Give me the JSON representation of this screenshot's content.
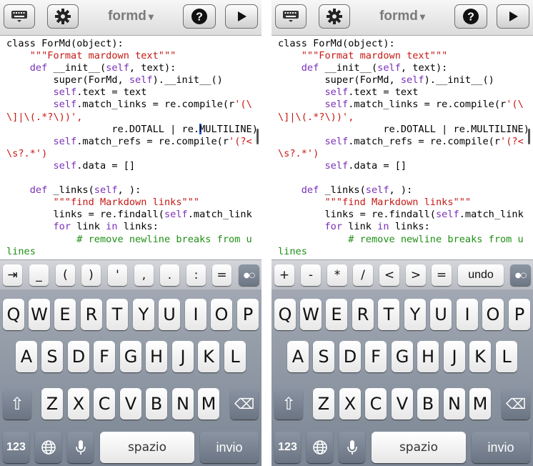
{
  "toolbar": {
    "title": "formd",
    "title_caret": "▾",
    "help_label": "?",
    "play_label": "▶"
  },
  "code": {
    "line1_a": "class ForMd(object):",
    "line2_pre": "    ",
    "line2_str": "\"\"\"Format mardown text\"\"\"",
    "line3_kw": "    def",
    "line3_rest": " __init__(",
    "line3_self": "self",
    "line3_end": ", text):",
    "line4_pre": "        super(ForMd, ",
    "line4_self": "self",
    "line4_end": ").__init__()",
    "line5_self": "        self",
    "line5_end": ".text = text",
    "line6_self": "        self",
    "line6_end": ".match_links = re.compile(r",
    "line6_str": "'(\\",
    "line7_str": "\\]|\\(.*?\\))',",
    "line8_left": "                  re.DOTALL | re.",
    "line8_right_left": "MULTILINE)",
    "line8_right_right": "MULTILINE)",
    "line9_self": "        self",
    "line9_end": ".match_refs = re.compile(r",
    "line9_str": "'(?<",
    "line10_str": "\\s?.*')",
    "line11_self": "        self",
    "line11_end": ".data = []",
    "line12": "",
    "line13_kw": "    def",
    "line13_end": " _links(",
    "line13_self": "self",
    "line13_end2": ", ):",
    "line14_pre": "        ",
    "line14_str": "\"\"\"find Markdown links\"\"\"",
    "line15_pre": "        links = re.findall(",
    "line15_self": "self",
    "line15_end": ".match_link",
    "line16_kw": "        for",
    "line16_mid": " link ",
    "line16_kw2": "in",
    "line16_end": " links:",
    "line17_cm": "            # remove newline breaks from u",
    "line18_cm": "lines"
  },
  "accessory_left": [
    "⇥",
    "_",
    "(",
    ")",
    "'",
    ",",
    ".",
    ":",
    "="
  ],
  "accessory_right": [
    "+",
    "-",
    "*",
    "/",
    "<",
    ">",
    "=",
    "undo"
  ],
  "accessory_toggle": "●○",
  "keyboard": {
    "row1": [
      "Q",
      "W",
      "E",
      "R",
      "T",
      "Y",
      "U",
      "I",
      "O",
      "P"
    ],
    "row2": [
      "A",
      "S",
      "D",
      "F",
      "G",
      "H",
      "J",
      "K",
      "L"
    ],
    "row3": [
      "Z",
      "X",
      "C",
      "V",
      "B",
      "N",
      "M"
    ],
    "numbers_label": "123",
    "space_label": "spazio",
    "return_label": "invio",
    "shift_icon": "⇧",
    "delete_icon": "⌫"
  }
}
